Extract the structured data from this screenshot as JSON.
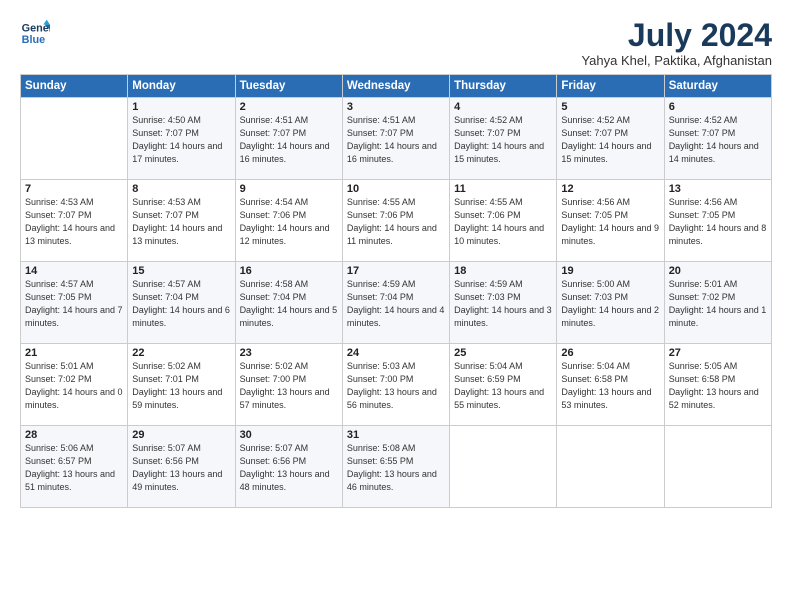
{
  "logo": {
    "line1": "General",
    "line2": "Blue"
  },
  "title": "July 2024",
  "location": "Yahya Khel, Paktika, Afghanistan",
  "days_header": [
    "Sunday",
    "Monday",
    "Tuesday",
    "Wednesday",
    "Thursday",
    "Friday",
    "Saturday"
  ],
  "weeks": [
    [
      {
        "day": "",
        "sunrise": "",
        "sunset": "",
        "daylight": ""
      },
      {
        "day": "1",
        "sunrise": "Sunrise: 4:50 AM",
        "sunset": "Sunset: 7:07 PM",
        "daylight": "Daylight: 14 hours and 17 minutes."
      },
      {
        "day": "2",
        "sunrise": "Sunrise: 4:51 AM",
        "sunset": "Sunset: 7:07 PM",
        "daylight": "Daylight: 14 hours and 16 minutes."
      },
      {
        "day": "3",
        "sunrise": "Sunrise: 4:51 AM",
        "sunset": "Sunset: 7:07 PM",
        "daylight": "Daylight: 14 hours and 16 minutes."
      },
      {
        "day": "4",
        "sunrise": "Sunrise: 4:52 AM",
        "sunset": "Sunset: 7:07 PM",
        "daylight": "Daylight: 14 hours and 15 minutes."
      },
      {
        "day": "5",
        "sunrise": "Sunrise: 4:52 AM",
        "sunset": "Sunset: 7:07 PM",
        "daylight": "Daylight: 14 hours and 15 minutes."
      },
      {
        "day": "6",
        "sunrise": "Sunrise: 4:52 AM",
        "sunset": "Sunset: 7:07 PM",
        "daylight": "Daylight: 14 hours and 14 minutes."
      }
    ],
    [
      {
        "day": "7",
        "sunrise": "Sunrise: 4:53 AM",
        "sunset": "Sunset: 7:07 PM",
        "daylight": "Daylight: 14 hours and 13 minutes."
      },
      {
        "day": "8",
        "sunrise": "Sunrise: 4:53 AM",
        "sunset": "Sunset: 7:07 PM",
        "daylight": "Daylight: 14 hours and 13 minutes."
      },
      {
        "day": "9",
        "sunrise": "Sunrise: 4:54 AM",
        "sunset": "Sunset: 7:06 PM",
        "daylight": "Daylight: 14 hours and 12 minutes."
      },
      {
        "day": "10",
        "sunrise": "Sunrise: 4:55 AM",
        "sunset": "Sunset: 7:06 PM",
        "daylight": "Daylight: 14 hours and 11 minutes."
      },
      {
        "day": "11",
        "sunrise": "Sunrise: 4:55 AM",
        "sunset": "Sunset: 7:06 PM",
        "daylight": "Daylight: 14 hours and 10 minutes."
      },
      {
        "day": "12",
        "sunrise": "Sunrise: 4:56 AM",
        "sunset": "Sunset: 7:05 PM",
        "daylight": "Daylight: 14 hours and 9 minutes."
      },
      {
        "day": "13",
        "sunrise": "Sunrise: 4:56 AM",
        "sunset": "Sunset: 7:05 PM",
        "daylight": "Daylight: 14 hours and 8 minutes."
      }
    ],
    [
      {
        "day": "14",
        "sunrise": "Sunrise: 4:57 AM",
        "sunset": "Sunset: 7:05 PM",
        "daylight": "Daylight: 14 hours and 7 minutes."
      },
      {
        "day": "15",
        "sunrise": "Sunrise: 4:57 AM",
        "sunset": "Sunset: 7:04 PM",
        "daylight": "Daylight: 14 hours and 6 minutes."
      },
      {
        "day": "16",
        "sunrise": "Sunrise: 4:58 AM",
        "sunset": "Sunset: 7:04 PM",
        "daylight": "Daylight: 14 hours and 5 minutes."
      },
      {
        "day": "17",
        "sunrise": "Sunrise: 4:59 AM",
        "sunset": "Sunset: 7:04 PM",
        "daylight": "Daylight: 14 hours and 4 minutes."
      },
      {
        "day": "18",
        "sunrise": "Sunrise: 4:59 AM",
        "sunset": "Sunset: 7:03 PM",
        "daylight": "Daylight: 14 hours and 3 minutes."
      },
      {
        "day": "19",
        "sunrise": "Sunrise: 5:00 AM",
        "sunset": "Sunset: 7:03 PM",
        "daylight": "Daylight: 14 hours and 2 minutes."
      },
      {
        "day": "20",
        "sunrise": "Sunrise: 5:01 AM",
        "sunset": "Sunset: 7:02 PM",
        "daylight": "Daylight: 14 hours and 1 minute."
      }
    ],
    [
      {
        "day": "21",
        "sunrise": "Sunrise: 5:01 AM",
        "sunset": "Sunset: 7:02 PM",
        "daylight": "Daylight: 14 hours and 0 minutes."
      },
      {
        "day": "22",
        "sunrise": "Sunrise: 5:02 AM",
        "sunset": "Sunset: 7:01 PM",
        "daylight": "Daylight: 13 hours and 59 minutes."
      },
      {
        "day": "23",
        "sunrise": "Sunrise: 5:02 AM",
        "sunset": "Sunset: 7:00 PM",
        "daylight": "Daylight: 13 hours and 57 minutes."
      },
      {
        "day": "24",
        "sunrise": "Sunrise: 5:03 AM",
        "sunset": "Sunset: 7:00 PM",
        "daylight": "Daylight: 13 hours and 56 minutes."
      },
      {
        "day": "25",
        "sunrise": "Sunrise: 5:04 AM",
        "sunset": "Sunset: 6:59 PM",
        "daylight": "Daylight: 13 hours and 55 minutes."
      },
      {
        "day": "26",
        "sunrise": "Sunrise: 5:04 AM",
        "sunset": "Sunset: 6:58 PM",
        "daylight": "Daylight: 13 hours and 53 minutes."
      },
      {
        "day": "27",
        "sunrise": "Sunrise: 5:05 AM",
        "sunset": "Sunset: 6:58 PM",
        "daylight": "Daylight: 13 hours and 52 minutes."
      }
    ],
    [
      {
        "day": "28",
        "sunrise": "Sunrise: 5:06 AM",
        "sunset": "Sunset: 6:57 PM",
        "daylight": "Daylight: 13 hours and 51 minutes."
      },
      {
        "day": "29",
        "sunrise": "Sunrise: 5:07 AM",
        "sunset": "Sunset: 6:56 PM",
        "daylight": "Daylight: 13 hours and 49 minutes."
      },
      {
        "day": "30",
        "sunrise": "Sunrise: 5:07 AM",
        "sunset": "Sunset: 6:56 PM",
        "daylight": "Daylight: 13 hours and 48 minutes."
      },
      {
        "day": "31",
        "sunrise": "Sunrise: 5:08 AM",
        "sunset": "Sunset: 6:55 PM",
        "daylight": "Daylight: 13 hours and 46 minutes."
      },
      {
        "day": "",
        "sunrise": "",
        "sunset": "",
        "daylight": ""
      },
      {
        "day": "",
        "sunrise": "",
        "sunset": "",
        "daylight": ""
      },
      {
        "day": "",
        "sunrise": "",
        "sunset": "",
        "daylight": ""
      }
    ]
  ]
}
